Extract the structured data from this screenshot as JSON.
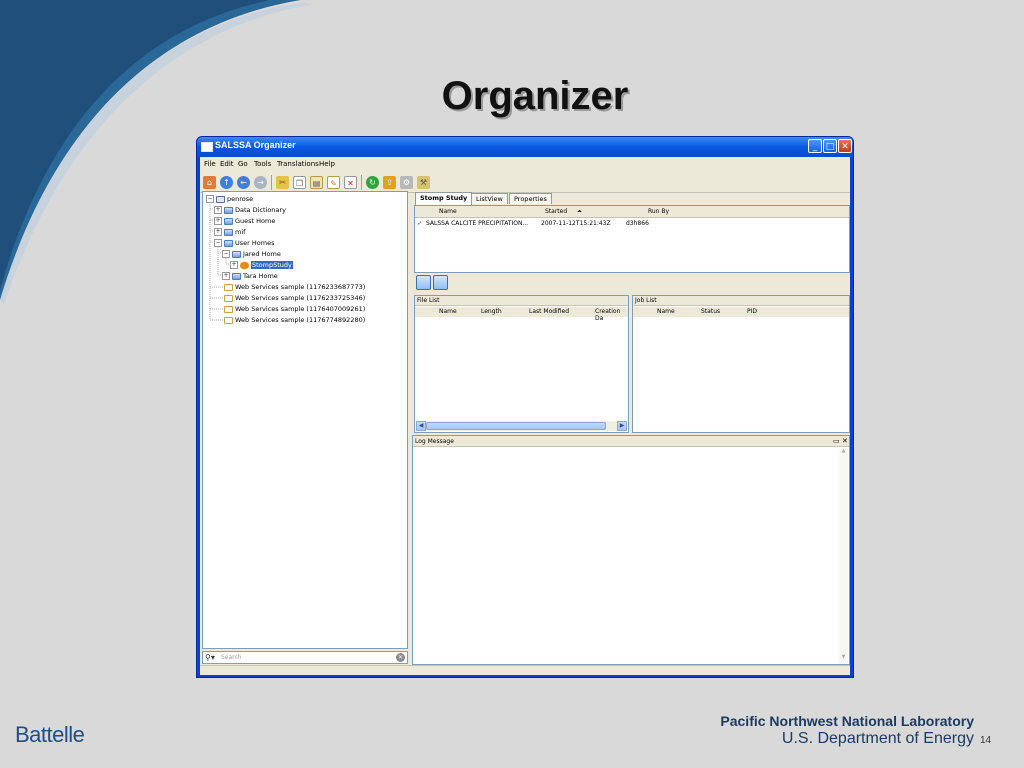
{
  "slide": {
    "title": "Organizer",
    "footer_logo": "Battelle",
    "footer_lab": "Pacific Northwest National Laboratory",
    "footer_dept": "U.S. Department of Energy",
    "page_number": "14"
  },
  "window": {
    "title": "SALSSA Organizer",
    "menu": [
      "File",
      "Edit",
      "Go",
      "Tools",
      "Translations",
      "Help"
    ]
  },
  "toolbar": {
    "icons": [
      "home-icon",
      "up-icon",
      "back-icon",
      "forward-icon",
      "cut-icon",
      "copy-icon",
      "paste-icon",
      "edit-icon",
      "delete-icon",
      "refresh-icon",
      "upload-icon",
      "tool-icon",
      "wrench-icon"
    ]
  },
  "tree": {
    "root": "penrose",
    "items": [
      "Data Dictionary",
      "Guest Home",
      "mif",
      "User Homes",
      "Jared Home",
      "StompStudy",
      "Tara Home",
      "Web Services sample (1176233687773)",
      "Web Services sample (1176233725346)",
      "Web Services sample (1176407009261)",
      "Web Services sample (1176774892280)"
    ]
  },
  "search": {
    "placeholder": "Search"
  },
  "tabs": [
    "Stomp Study",
    "ListView",
    "Properties"
  ],
  "study_grid": {
    "columns": [
      "Name",
      "Started",
      "Run By"
    ],
    "rows": [
      {
        "name": "SALSSA CALCITE PRECIPITATION...",
        "started": "2007-11-12T15:21:43Z",
        "run_by": "d3h866"
      }
    ]
  },
  "file_list": {
    "title": "File List",
    "columns": [
      "Name",
      "Length",
      "Last Modified",
      "Creation Da"
    ]
  },
  "job_list": {
    "title": "Job List",
    "columns": [
      "Name",
      "Status",
      "PID"
    ]
  },
  "log": {
    "title": "Log Message"
  }
}
